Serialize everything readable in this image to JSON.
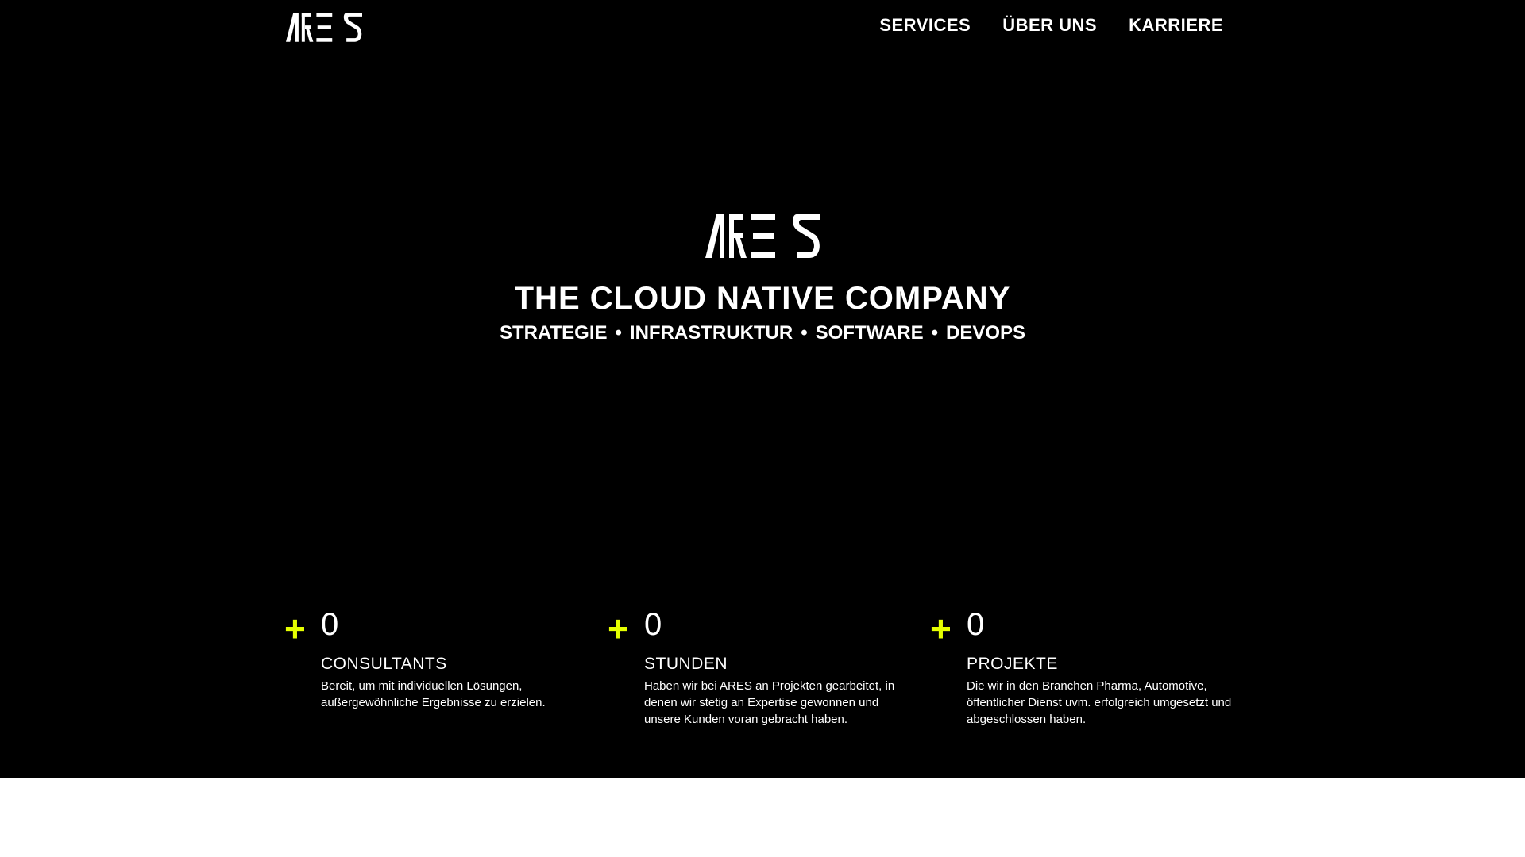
{
  "brand": {
    "logo_text": "ARES"
  },
  "nav": {
    "items": [
      {
        "label": "SERVICES"
      },
      {
        "label": "ÜBER UNS"
      },
      {
        "label": "KARRIERE"
      }
    ]
  },
  "hero": {
    "title": "THE CLOUD NATIVE COMPANY",
    "subtitle": [
      "STRATEGIE",
      "INFRASTRUKTUR",
      "SOFTWARE",
      "DEVOPS"
    ],
    "separator": "•"
  },
  "stats": [
    {
      "plus": "+",
      "value": "0",
      "label": "CONSULTANTS",
      "desc": "Bereit, um mit individuellen Lösungen, außergewöhnliche Ergebnisse zu erzielen."
    },
    {
      "plus": "+",
      "value": "0",
      "label": "STUNDEN",
      "desc": "Haben wir bei ARES an Projekten gearbeitet, in denen wir stetig an Expertise gewonnen und unsere Kunden voran gebracht haben."
    },
    {
      "plus": "+",
      "value": "0",
      "label": "PROJEKTE",
      "desc": "Die wir in den Branchen Pharma, Automotive, öffentlicher Dienst uvm. erfolgreich umgesetzt und abgeschlossen haben."
    }
  ],
  "colors": {
    "accent": "#e5ff00",
    "background": "#000000"
  }
}
